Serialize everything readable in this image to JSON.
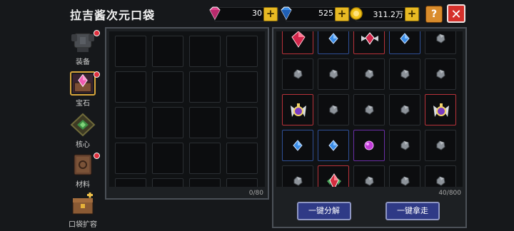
{
  "header": {
    "title": "拉吉酱次元口袋"
  },
  "resources": [
    {
      "name": "pink-gem",
      "value": "30",
      "color": "#e0468f"
    },
    {
      "name": "blue-gem",
      "value": "525",
      "color": "#3a8de8"
    },
    {
      "name": "gold-coin",
      "value": "311.2万",
      "color": "#f1c21b"
    }
  ],
  "buttons": {
    "help": "?",
    "close": "✕",
    "dismantle_all": "一键分解",
    "take_all": "一键拿走"
  },
  "sidebar": {
    "items": [
      {
        "label": "装备",
        "icon": "armor-icon",
        "badge": true,
        "active": false
      },
      {
        "label": "宝石",
        "icon": "gem-chest-icon",
        "badge": true,
        "active": true
      },
      {
        "label": "核心",
        "icon": "core-icon",
        "badge": false,
        "active": false
      },
      {
        "label": "材料",
        "icon": "material-book-icon",
        "badge": true,
        "active": false
      },
      {
        "label": "口袋扩容",
        "icon": "chest-expand-icon",
        "badge": false,
        "active": false
      }
    ]
  },
  "left_panel": {
    "count": "0/80"
  },
  "right_panel": {
    "count": "40/800",
    "rows": [
      [
        "red-gem",
        "blue-gem",
        "winged-red-gem",
        "blue-gem",
        "stone"
      ],
      [
        "stone",
        "stone",
        "stone",
        "stone",
        "stone"
      ],
      [
        "winged-amulet",
        "stone",
        "stone",
        "stone",
        "winged-amulet"
      ],
      [
        "blue-gem",
        "blue-gem",
        "purple-gem",
        "stone",
        "stone"
      ],
      [
        "stone",
        "crystal-amulet",
        "stone",
        "stone",
        "stone"
      ]
    ]
  }
}
